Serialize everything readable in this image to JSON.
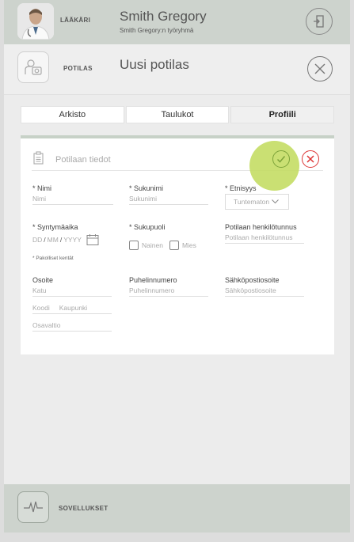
{
  "header": {
    "role_label": "LÄÄKÄRI",
    "user_name": "Smith Gregory",
    "user_group": "Smith Gregory:n työryhmä"
  },
  "subheader": {
    "section_label": "POTILAS",
    "title": "Uusi potilas"
  },
  "tabs": [
    {
      "label": "Arkisto"
    },
    {
      "label": "Taulukot"
    },
    {
      "label": "Profiili"
    }
  ],
  "form": {
    "title": "Potilaan tiedot",
    "first_name": {
      "label": "* Nimi",
      "placeholder": "Nimi"
    },
    "last_name": {
      "label": "* Sukunimi",
      "placeholder": "Sukunimi"
    },
    "ethnicity": {
      "label": "* Etnisyys",
      "value": "Tuntematon"
    },
    "birthdate": {
      "label": "* Syntymäaika",
      "dd": "DD",
      "mm": "MM",
      "yyyy": "YYYY",
      "sep": "/"
    },
    "gender": {
      "label": "* Sukupuoli",
      "option_female": "Nainen",
      "option_male": "Mies"
    },
    "ssn": {
      "label": "Potilaan henkilötunnus",
      "placeholder": "Potilaan henkilötunnus"
    },
    "required_note": "* Pakolliset kentät",
    "address": {
      "label": "Osoite",
      "street_placeholder": "Katu",
      "zip_placeholder": "Koodi",
      "city_placeholder": "Kaupunki",
      "state_placeholder": "Osavaltio"
    },
    "phone": {
      "label": "Puhelinnumero",
      "placeholder": "Puhelinnumero"
    },
    "email": {
      "label": "Sähköpostiosoite",
      "placeholder": "Sähköpostiosoite"
    }
  },
  "footer": {
    "apps_label": "SOVELLUKSET"
  },
  "colors": {
    "header_bg": "#cdd3cd",
    "confirm": "#7da33a",
    "cancel": "#dd3333",
    "highlight": "#c1da5a"
  }
}
